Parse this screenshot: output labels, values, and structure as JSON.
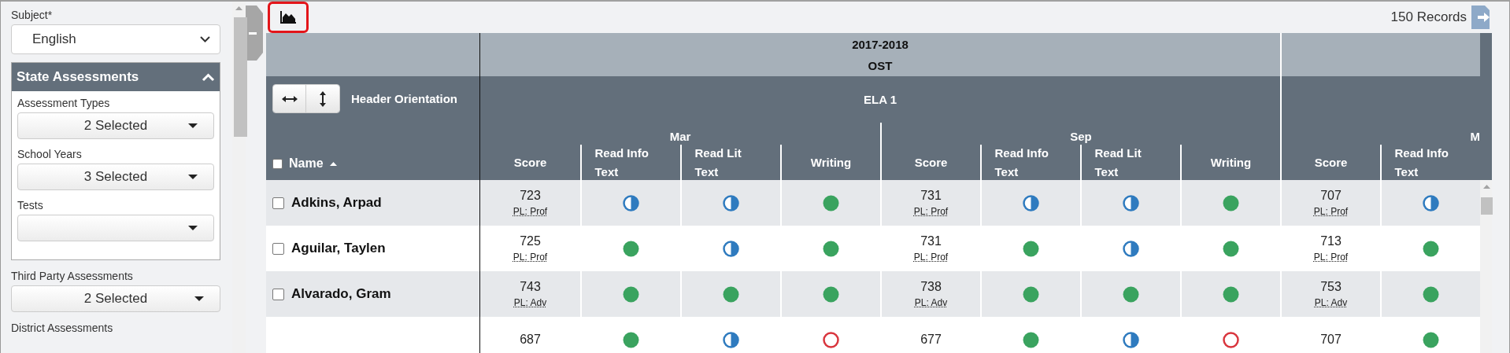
{
  "sidebar": {
    "subject": {
      "label": "Subject*",
      "value": "English"
    },
    "sections": [
      {
        "title": "State Assessments",
        "expanded": true,
        "filters": [
          {
            "label": "Assessment Types",
            "value": "2 Selected"
          },
          {
            "label": "School Years",
            "value": "3 Selected"
          },
          {
            "label": "Tests"
          }
        ]
      }
    ],
    "filters": [
      {
        "label": "Third Party Assessments",
        "value": "2 Selected"
      },
      {
        "label": "District Assessments"
      }
    ]
  },
  "toolbar": {
    "records": "150 Records"
  },
  "table": {
    "header_orientation": {
      "label": "Header Orientation"
    },
    "name_column": {
      "label": "Name",
      "checked": false
    },
    "groups": [
      {
        "year": "2017-2018",
        "test": "OST",
        "subject": "ELA 1",
        "months": [
          {
            "name": "Mar",
            "columns": [
              "Score",
              "Read Info Text",
              "Read Lit Text",
              "Writing"
            ]
          },
          {
            "name": "Sep",
            "columns": [
              "Score",
              "Read Info Text",
              "Read Lit Text",
              "Writing"
            ]
          }
        ]
      },
      {
        "months": [
          {
            "name": "M",
            "columns": [
              "Score",
              "Read Info Text"
            ]
          }
        ]
      }
    ],
    "rows": [
      {
        "name": "Adkins, Arpad",
        "checked": false,
        "cells": [
          {
            "kind": "score",
            "score": "723",
            "pl": "PL: Prof"
          },
          {
            "kind": "partial"
          },
          {
            "kind": "partial"
          },
          {
            "kind": "met"
          },
          {
            "kind": "score",
            "score": "731",
            "pl": "PL: Prof"
          },
          {
            "kind": "partial"
          },
          {
            "kind": "partial"
          },
          {
            "kind": "met"
          },
          {
            "kind": "score",
            "score": "707",
            "pl": "PL: Prof"
          },
          {
            "kind": "partial"
          }
        ]
      },
      {
        "name": "Aguilar, Taylen",
        "checked": false,
        "cells": [
          {
            "kind": "score",
            "score": "725",
            "pl": "PL: Prof"
          },
          {
            "kind": "met"
          },
          {
            "kind": "partial"
          },
          {
            "kind": "met"
          },
          {
            "kind": "score",
            "score": "731",
            "pl": "PL: Prof"
          },
          {
            "kind": "met"
          },
          {
            "kind": "partial"
          },
          {
            "kind": "met"
          },
          {
            "kind": "score",
            "score": "713",
            "pl": "PL: Prof"
          },
          {
            "kind": "met"
          }
        ]
      },
      {
        "name": "Alvarado, Gram",
        "checked": false,
        "cells": [
          {
            "kind": "score",
            "score": "743",
            "pl": "PL: Adv"
          },
          {
            "kind": "met"
          },
          {
            "kind": "met"
          },
          {
            "kind": "met"
          },
          {
            "kind": "score",
            "score": "738",
            "pl": "PL: Adv"
          },
          {
            "kind": "met"
          },
          {
            "kind": "met"
          },
          {
            "kind": "met"
          },
          {
            "kind": "score",
            "score": "753",
            "pl": "PL: Adv"
          },
          {
            "kind": "met"
          }
        ]
      },
      {
        "cells": [
          {
            "kind": "score",
            "score": "687"
          },
          {
            "kind": "met"
          },
          {
            "kind": "partial"
          },
          {
            "kind": "not_met"
          },
          {
            "kind": "score",
            "score": "677"
          },
          {
            "kind": "met"
          },
          {
            "kind": "partial"
          },
          {
            "kind": "not_met"
          },
          {
            "kind": "score",
            "score": "707"
          },
          {
            "kind": "met"
          }
        ]
      }
    ]
  }
}
